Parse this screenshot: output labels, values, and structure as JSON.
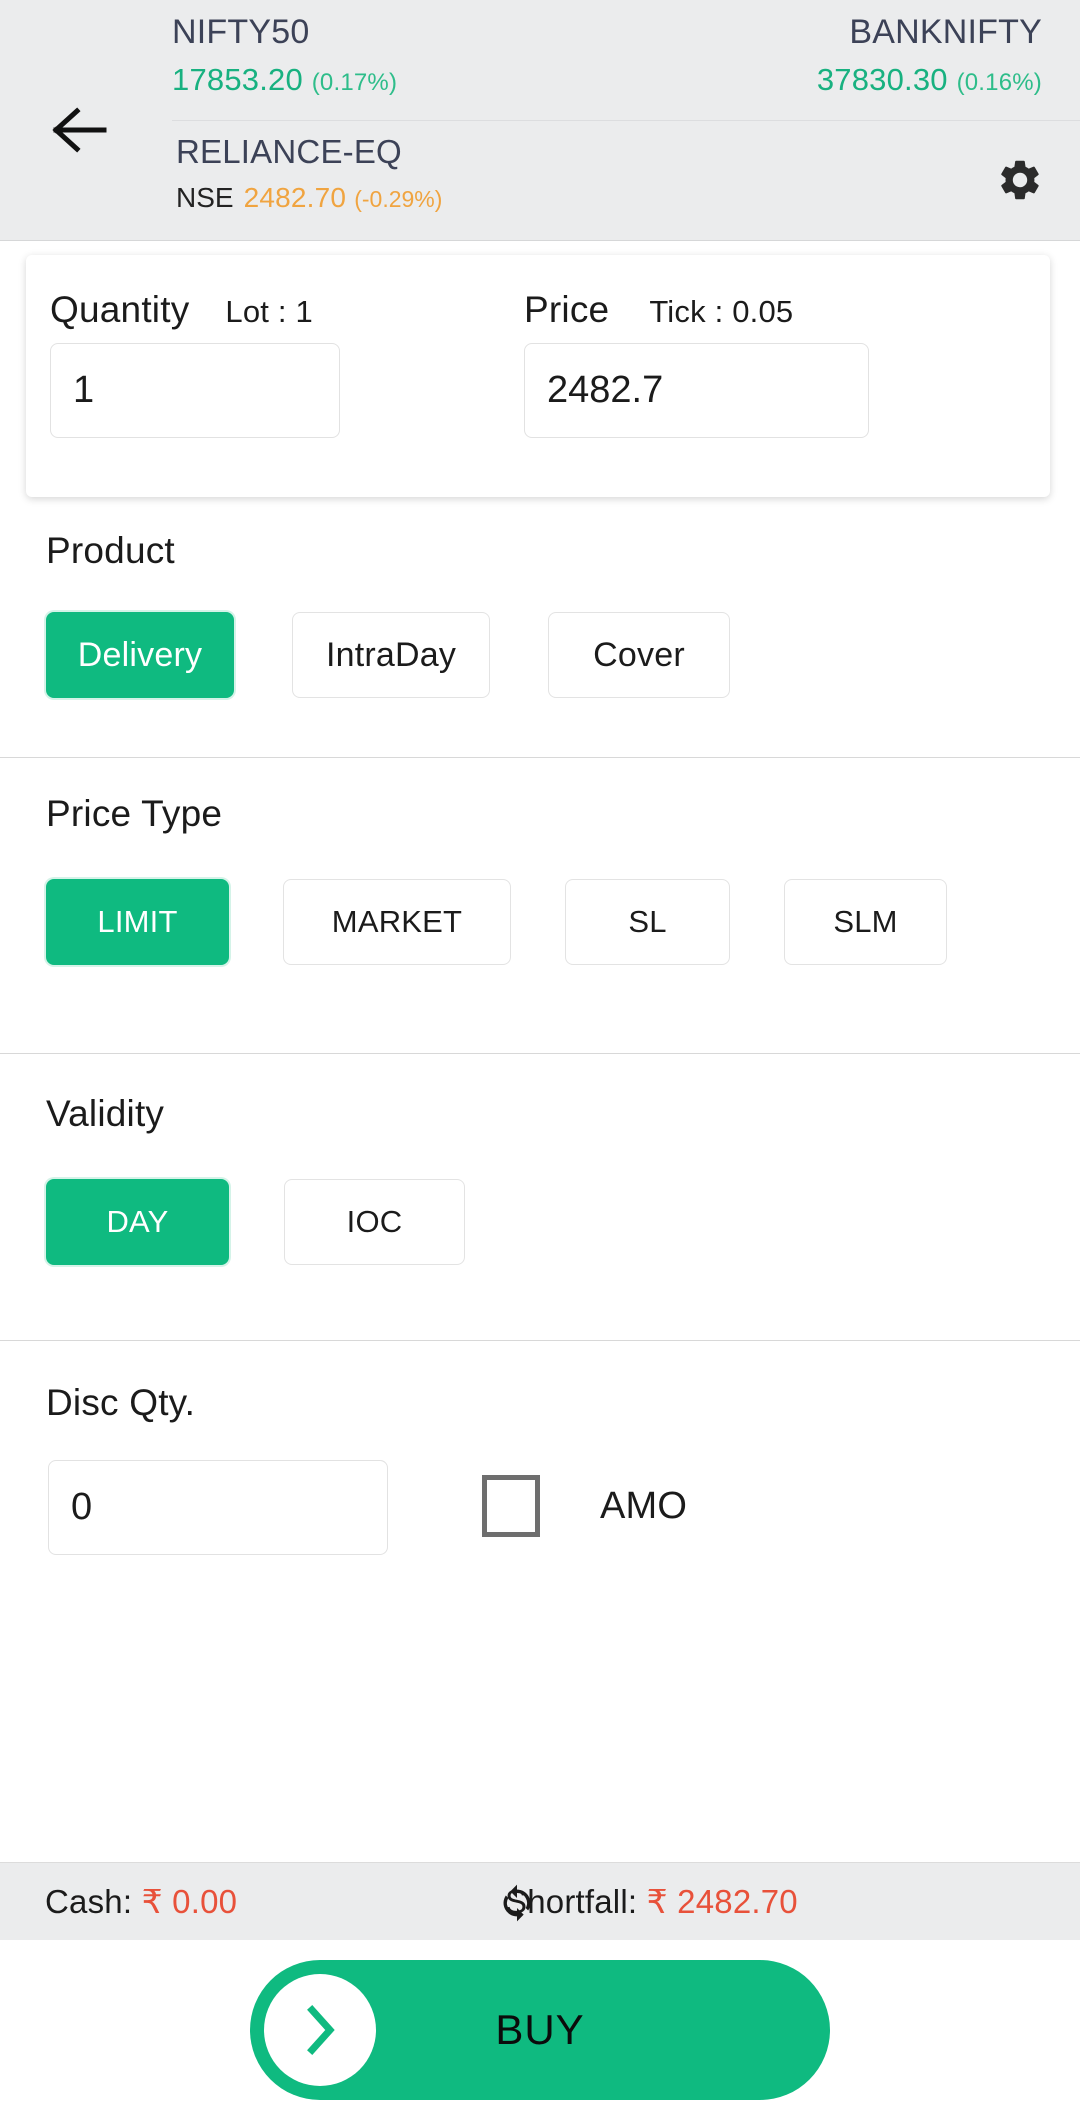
{
  "header": {
    "back_icon": "arrow-left-icon",
    "gear_icon": "gear-icon",
    "indices": [
      {
        "name": "NIFTY50",
        "value": "17853.20",
        "change": "(0.17%)"
      },
      {
        "name": "BANKNIFTY",
        "value": "37830.30",
        "change": "(0.16%)"
      }
    ],
    "symbol": {
      "name": "RELIANCE-EQ",
      "exchange": "NSE",
      "price": "2482.70",
      "change": "(-0.29%)"
    }
  },
  "order_card": {
    "quantity": {
      "label": "Quantity",
      "sub": "Lot : 1",
      "value": "1"
    },
    "price": {
      "label": "Price",
      "sub": "Tick : 0.05",
      "value": "2482.7"
    }
  },
  "product": {
    "title": "Product",
    "options": [
      {
        "label": "Delivery",
        "selected": true
      },
      {
        "label": "IntraDay",
        "selected": false
      },
      {
        "label": "Cover",
        "selected": false
      }
    ]
  },
  "price_type": {
    "title": "Price Type",
    "options": [
      {
        "label": "LIMIT",
        "selected": true
      },
      {
        "label": "MARKET",
        "selected": false
      },
      {
        "label": "SL",
        "selected": false
      },
      {
        "label": "SLM",
        "selected": false
      }
    ]
  },
  "validity": {
    "title": "Validity",
    "options": [
      {
        "label": "DAY",
        "selected": true
      },
      {
        "label": "IOC",
        "selected": false
      }
    ]
  },
  "disc_qty": {
    "title": "Disc Qty.",
    "value": "0",
    "amo_label": "AMO",
    "amo_checked": false
  },
  "status": {
    "cash_label": "Cash:",
    "cash_value": "₹ 0.00",
    "sync_icon": "sync-icon",
    "shortfall_label": "Shortfall:",
    "shortfall_value": "₹ 2482.70"
  },
  "action": {
    "buy_label": "BUY",
    "slider_icon": "chevron-right-icon"
  },
  "colors": {
    "accent_green": "#0fba80",
    "up_green": "#18b180",
    "amber": "#f0a440",
    "red": "#e8513a",
    "header_bg": "#ebeced",
    "symbol_navy": "#3c4257"
  }
}
